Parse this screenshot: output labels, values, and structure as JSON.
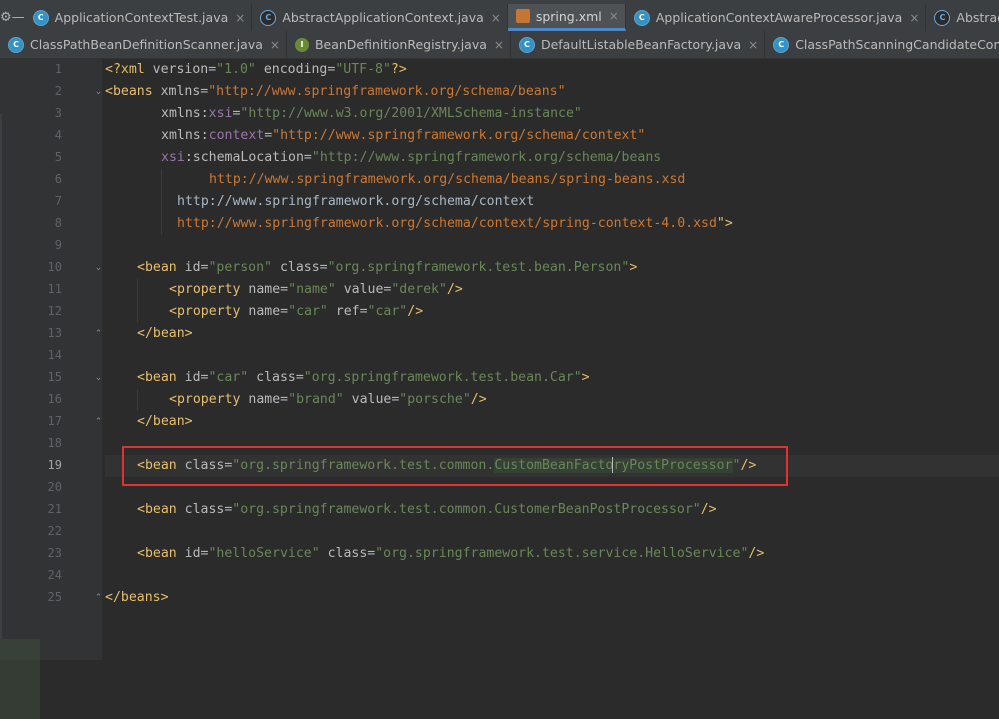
{
  "tabs_row1": [
    {
      "label": "ApplicationContextTest.java",
      "icon": "class-icon",
      "active": false
    },
    {
      "label": "AbstractApplicationContext.java",
      "icon": "abstract-class-icon",
      "active": false
    },
    {
      "label": "spring.xml",
      "icon": "xml-file-icon",
      "active": true
    },
    {
      "label": "ApplicationContextAwareProcessor.java",
      "icon": "class-icon",
      "active": false
    },
    {
      "label": "AbstractRefresha",
      "icon": "abstract-class-icon",
      "active": false
    }
  ],
  "tabs_row2": [
    {
      "label": "ClassPathBeanDefinitionScanner.java",
      "icon": "class-icon",
      "active": false
    },
    {
      "label": "BeanDefinitionRegistry.java",
      "icon": "interface-icon",
      "active": false
    },
    {
      "label": "DefaultListableBeanFactory.java",
      "icon": "class-icon",
      "active": false
    },
    {
      "label": "ClassPathScanningCandidateComponen",
      "icon": "class-icon",
      "active": false
    }
  ],
  "editor": {
    "current_line": 19,
    "line_numbers": [
      "1",
      "2",
      "3",
      "4",
      "5",
      "6",
      "7",
      "8",
      "9",
      "10",
      "11",
      "12",
      "13",
      "14",
      "15",
      "16",
      "17",
      "18",
      "19",
      "20",
      "21",
      "22",
      "23",
      "24",
      "25"
    ],
    "lines": {
      "l1": {
        "a": "<?xml ",
        "b": "version",
        "c": "=",
        "d": "\"1.0\"",
        "e": " ",
        "f": "encoding",
        "g": "=",
        "h": "\"UTF-8\"",
        "i": "?>"
      },
      "l2": {
        "tag": "<beans ",
        "attr": "xmlns",
        "eq": "=",
        "val": "\"http://www.springframework.org/schema/beans\""
      },
      "l3": {
        "ns": "xmlns:",
        "nsname": "xsi",
        "eq": "=",
        "val": "\"http://www.w3.org/2001/XMLSchema-instance\""
      },
      "l4": {
        "ns": "xmlns:",
        "nsname": "context",
        "eq": "=",
        "val": "\"http://www.springframework.org/schema/context\""
      },
      "l5": {
        "ns": "xsi",
        "nsrest": ":schemaLocation",
        "eq": "=",
        "val": "\"http://www.springframework.org/schema/beans"
      },
      "l6": {
        "url": "http://www.springframework.org/schema/beans/spring-beans.xsd"
      },
      "l7": {
        "val": "http://www.springframework.org/schema/context"
      },
      "l8": {
        "url": "http://www.springframework.org/schema/context/spring-context-4.0.xsd",
        "end": "\">"
      },
      "l10": {
        "tag": "<bean ",
        "a1": "id",
        "v1": "\"person\"",
        "a2": " class",
        "v2": "\"org.springframework.test.bean.Person\"",
        "end": ">"
      },
      "l11": {
        "tag": "<property ",
        "a1": "name",
        "v1": "\"name\"",
        "a2": " value",
        "v2": "\"derek\"",
        "end": "/>"
      },
      "l12": {
        "tag": "<property ",
        "a1": "name",
        "v1": "\"car\"",
        "a2": " ref",
        "v2": "\"car\"",
        "end": "/>"
      },
      "l13": {
        "tag": "</bean>"
      },
      "l15": {
        "tag": "<bean ",
        "a1": "id",
        "v1": "\"car\"",
        "a2": " class",
        "v2": "\"org.springframework.test.bean.Car\"",
        "end": ">"
      },
      "l16": {
        "tag": "<property ",
        "a1": "name",
        "v1": "\"brand\"",
        "a2": " value",
        "v2": "\"porsche\"",
        "end": "/>"
      },
      "l17": {
        "tag": "</bean>"
      },
      "l19": {
        "tag": "<bean ",
        "a1": "class",
        "v1a": "\"org.springframework.test.common.",
        "hl1": "CustomBeanFacto",
        "hl2": "ryPostProcessor",
        "v1b": "\"",
        "end": "/>"
      },
      "l21": {
        "tag": "<bean ",
        "a1": "class",
        "v1": "\"org.springframework.test.common.CustomerBeanPostProcessor\"",
        "end": "/>"
      },
      "l23": {
        "tag": "<bean ",
        "a1": "id",
        "v1": "\"helloService\"",
        "a2": " class",
        "v2": "\"org.springframework.test.service.HelloService\"",
        "end": "/>"
      },
      "l25": {
        "tag": "</beans>"
      }
    }
  }
}
